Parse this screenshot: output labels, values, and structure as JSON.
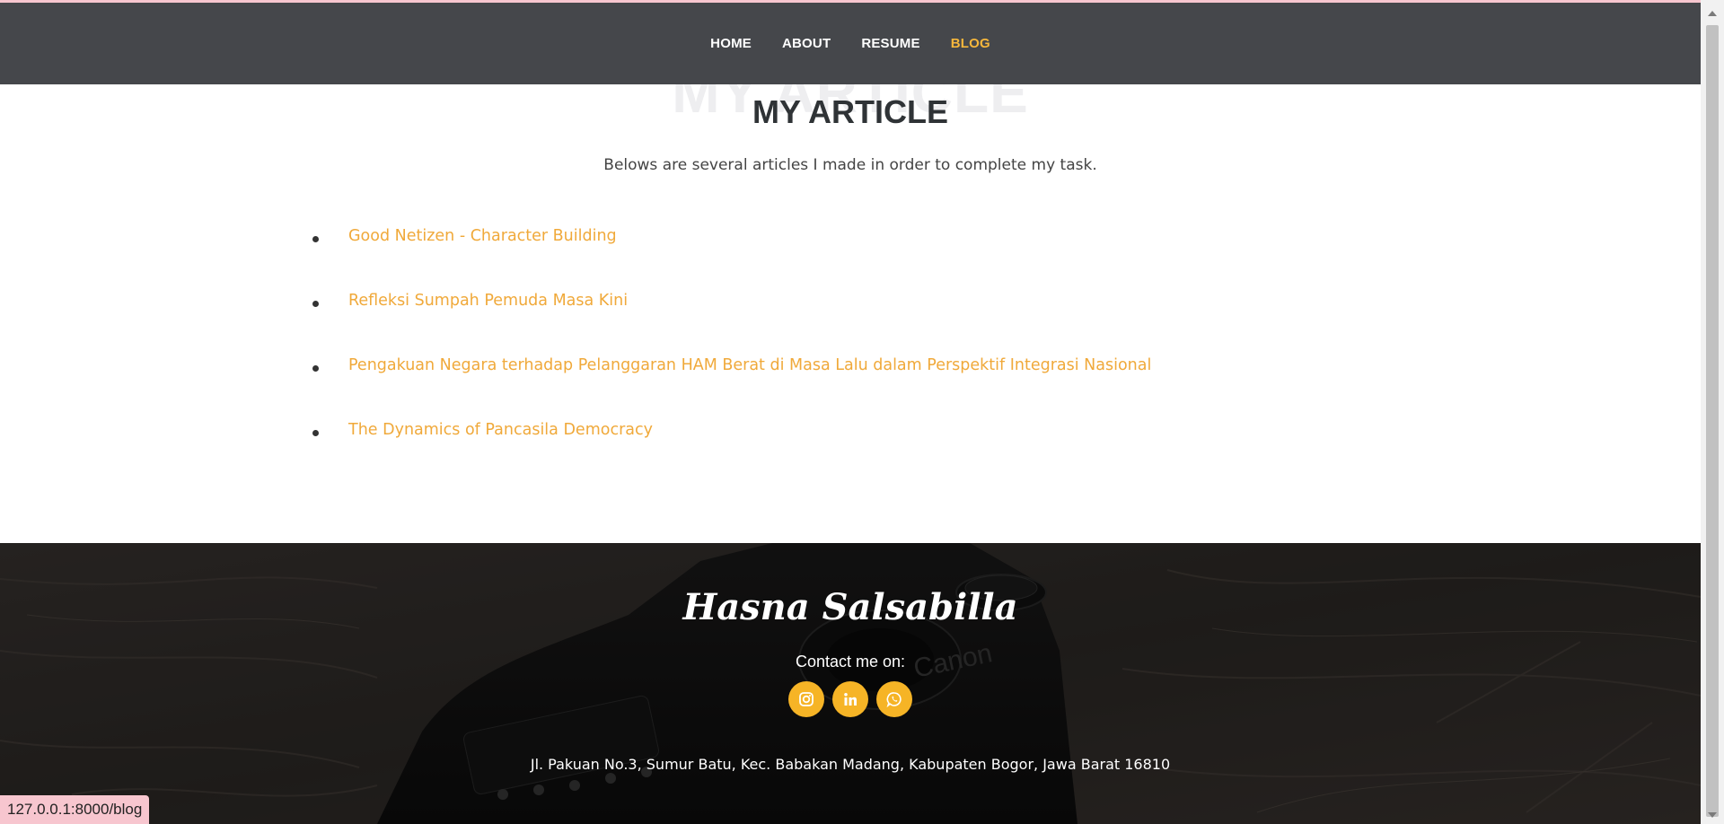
{
  "nav": {
    "items": [
      {
        "label": "HOME"
      },
      {
        "label": "ABOUT"
      },
      {
        "label": "RESUME"
      },
      {
        "label": "BLOG"
      }
    ],
    "active": "BLOG"
  },
  "section": {
    "title": "MY ARTICLE",
    "ghost_title": "MY ARTICLE",
    "subtitle": "Belows are several articles I made in order to complete my task.",
    "articles": [
      {
        "label": "Good Netizen - Character Building"
      },
      {
        "label": "Refleksi Sumpah Pemuda Masa Kini"
      },
      {
        "label": "Pengakuan Negara terhadap Pelanggaran HAM Berat di Masa Lalu dalam Perspektif Integrasi Nasional"
      },
      {
        "label": "The Dynamics of Pancasila Democracy"
      }
    ]
  },
  "footer": {
    "name": "Hasna Salsabilla",
    "contact_label": "Contact me on:",
    "social": [
      {
        "icon": "instagram-icon"
      },
      {
        "icon": "linkedin-icon"
      },
      {
        "icon": "whatsapp-icon"
      }
    ],
    "address": "Jl. Pakuan No.3, Sumur Batu, Kec. Babakan Madang, Kabupaten Bogor, Jawa Barat 16810"
  },
  "status_bar": {
    "url": "127.0.0.1:8000/blog"
  },
  "colors": {
    "accent": "#f6b73c",
    "nav_bg": "#45474b",
    "link": "#f0a93a",
    "social_bg": "#f6b426",
    "status_bg": "#f7c6cf"
  }
}
